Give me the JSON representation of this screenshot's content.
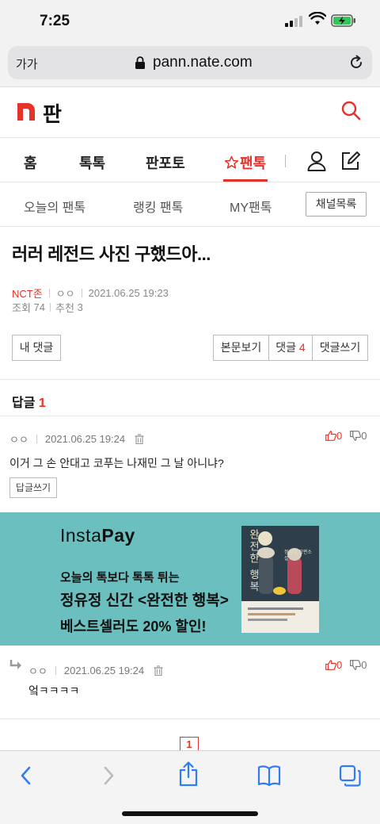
{
  "status_bar": {
    "time": "7:25"
  },
  "browser": {
    "text_size_label": "가가",
    "url": "pann.nate.com",
    "toolbar": {
      "back": "chevron-left-icon",
      "forward": "chevron-right-icon",
      "share": "share-icon",
      "bookmarks": "book-icon",
      "tabs": "tabs-icon"
    }
  },
  "site": {
    "logo_text": "판",
    "brand_color": "#e4332b"
  },
  "main_nav": {
    "items": [
      "홈",
      "톡톡",
      "판포토",
      "팬톡"
    ],
    "active": "팬톡"
  },
  "sub_nav": {
    "items": [
      "오늘의 팬톡",
      "랭킹 팬톡",
      "MY팬톡"
    ],
    "channel_button": "채널목록"
  },
  "article": {
    "title": "러러 레전드 사진 구했드아...",
    "category": "NCT존",
    "author": "ㅇㅇ",
    "date": "2021.06.25 19:23",
    "views_label": "조회",
    "views": "74",
    "recommend_label": "추천",
    "recommends": "3"
  },
  "actions": {
    "my_comments": "내 댓글",
    "view_post": "본문보기",
    "comments_label": "댓글",
    "comments_count": "4",
    "write_comment": "댓글쓰기"
  },
  "replies": {
    "label": "답글",
    "count": "1"
  },
  "comments": [
    {
      "author": "ㅇㅇ",
      "date": "2021.06.25 19:24",
      "up": "0",
      "down": "0",
      "text": "이거 그 손 안대고 코푸는 나재민 그 날 아니냐?",
      "reply_button": "답글쓰기"
    },
    {
      "author": "ㅇㅇ",
      "date": "2021.06.25 19:24",
      "up": "0",
      "down": "0",
      "text": "엌ㅋㅋㅋㅋ"
    }
  ],
  "ad": {
    "brand_prefix": "Insta",
    "brand_suffix": "Pay",
    "line1": "오늘의 톡보다 톡톡 튀는",
    "line2": "정유정 신간 <완전한 행복>",
    "line3": "베스트셀러도 20% 할인!",
    "book_title": "완전한 행복",
    "book_author": "정유정 장편소설",
    "background_color": "#6bbfbf"
  },
  "pagination": {
    "current": "1"
  }
}
